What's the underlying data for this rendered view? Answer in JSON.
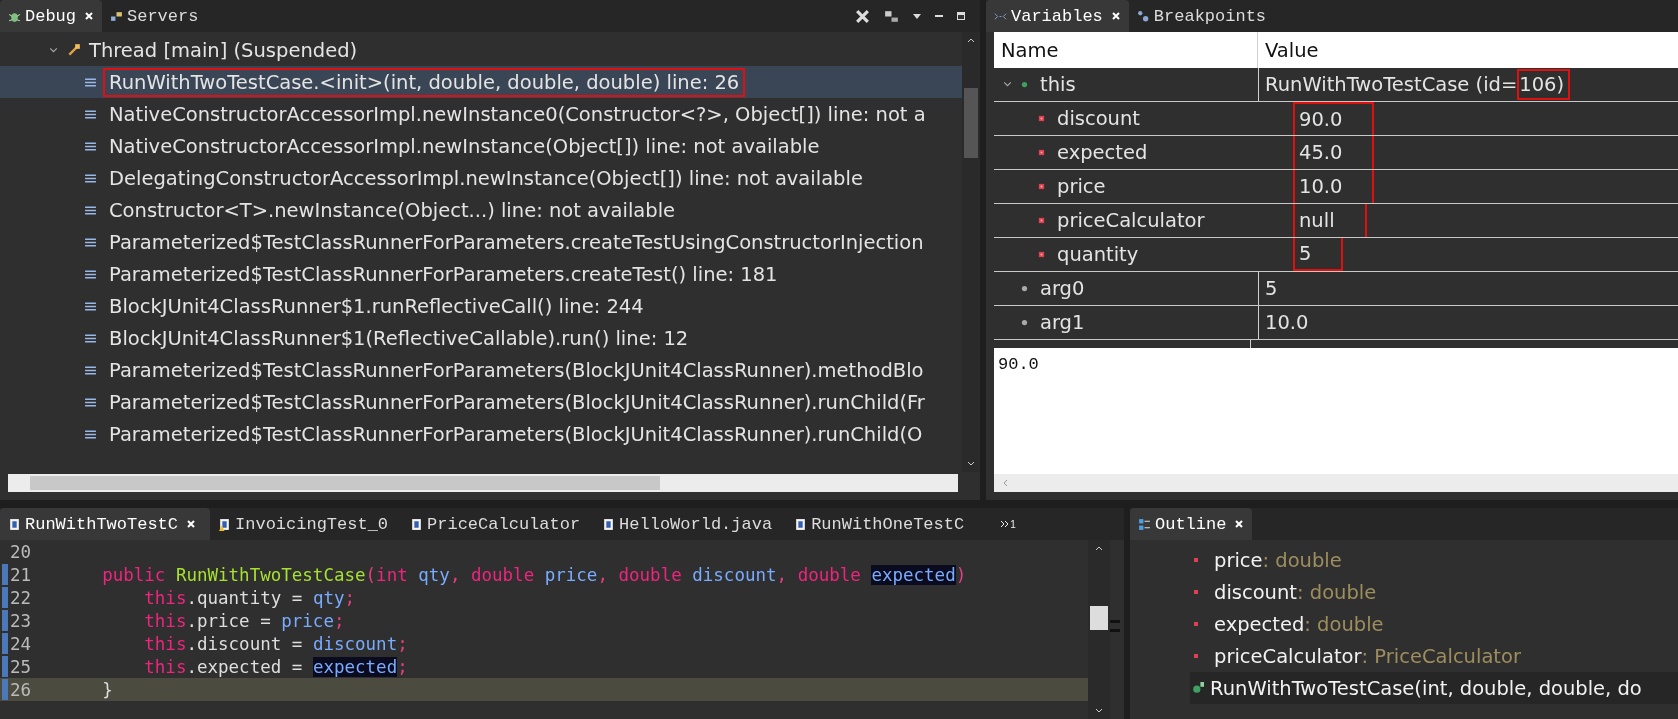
{
  "debug_view": {
    "tabs": [
      {
        "label": "Debug",
        "selected": true
      },
      {
        "label": "Servers",
        "selected": false
      }
    ],
    "thread": {
      "label": "Thread [main] (Suspended)",
      "expanded": true,
      "frames": [
        {
          "label": "RunWithTwoTestCase.<init>(int, double, double, double) line: 26",
          "selected": true,
          "boxed": true
        },
        {
          "label": "NativeConstructorAccessorImpl.newInstance0(Constructor<?>, Object[]) line: not a",
          "selected": false,
          "boxed": false
        },
        {
          "label": "NativeConstructorAccessorImpl.newInstance(Object[]) line: not available",
          "selected": false,
          "boxed": false
        },
        {
          "label": "DelegatingConstructorAccessorImpl.newInstance(Object[]) line: not available",
          "selected": false,
          "boxed": false
        },
        {
          "label": "Constructor<T>.newInstance(Object...) line: not available",
          "selected": false,
          "boxed": false
        },
        {
          "label": "Parameterized$TestClassRunnerForParameters.createTestUsingConstructorInjection",
          "selected": false,
          "boxed": false
        },
        {
          "label": "Parameterized$TestClassRunnerForParameters.createTest() line: 181",
          "selected": false,
          "boxed": false
        },
        {
          "label": "BlockJUnit4ClassRunner$1.runReflectiveCall() line: 244",
          "selected": false,
          "boxed": false
        },
        {
          "label": "BlockJUnit4ClassRunner$1(ReflectiveCallable).run() line: 12",
          "selected": false,
          "boxed": false
        },
        {
          "label": "Parameterized$TestClassRunnerForParameters(BlockJUnit4ClassRunner).methodBlo",
          "selected": false,
          "boxed": false
        },
        {
          "label": "Parameterized$TestClassRunnerForParameters(BlockJUnit4ClassRunner).runChild(Fr",
          "selected": false,
          "boxed": false
        },
        {
          "label": "Parameterized$TestClassRunnerForParameters(BlockJUnit4ClassRunner).runChild(O",
          "selected": false,
          "boxed": false
        }
      ]
    }
  },
  "variables_view": {
    "tabs": [
      {
        "label": "Variables",
        "selected": true
      },
      {
        "label": "Breakpoints",
        "selected": false
      }
    ],
    "columns": [
      "Name",
      "Value"
    ],
    "rows": [
      {
        "name": "this",
        "kind": "object",
        "expanded": true,
        "value": "RunWithTwoTestCase  (id=",
        "value_boxed": "106)",
        "boxed": false,
        "children": [
          {
            "name": "discount",
            "kind": "field",
            "value": "90.0",
            "boxed": true
          },
          {
            "name": "expected",
            "kind": "field",
            "value": "45.0",
            "boxed": true
          },
          {
            "name": "price",
            "kind": "field",
            "value": "10.0",
            "boxed": true
          },
          {
            "name": "priceCalculator",
            "kind": "field",
            "value": "null",
            "boxed": true
          },
          {
            "name": "quantity",
            "kind": "field",
            "value": "5",
            "boxed": true
          }
        ]
      },
      {
        "name": "arg0",
        "kind": "local",
        "value": "5",
        "boxed": false
      },
      {
        "name": "arg1",
        "kind": "local",
        "value": "10.0",
        "boxed": false
      }
    ],
    "detail": "90.0"
  },
  "editor": {
    "tabs": [
      {
        "label": "RunWithTwoTestC",
        "selected": true,
        "kind": "file"
      },
      {
        "label": "InvoicingTest_0",
        "selected": false,
        "kind": "warning"
      },
      {
        "label": "PriceCalculator",
        "selected": false,
        "kind": "file"
      },
      {
        "label": "HelloWorld.java",
        "selected": false,
        "kind": "file"
      },
      {
        "label": "RunWithOneTestC",
        "selected": false,
        "kind": "file"
      }
    ],
    "overflow_count": "1",
    "lines": [
      {
        "number": "20",
        "current": false
      },
      {
        "number": "21",
        "current": false,
        "tokens": [
          {
            "text": "    public ",
            "kind": "keyword"
          },
          {
            "text": "RunWithTwoTestCase",
            "kind": "method"
          },
          {
            "text": "(",
            "kind": "punct"
          },
          {
            "text": "int ",
            "kind": "keyword"
          },
          {
            "text": "qty",
            "kind": "param"
          },
          {
            "text": ", ",
            "kind": "punct"
          },
          {
            "text": "double ",
            "kind": "keyword"
          },
          {
            "text": "price",
            "kind": "param"
          },
          {
            "text": ", ",
            "kind": "punct"
          },
          {
            "text": "double ",
            "kind": "keyword"
          },
          {
            "text": "discount",
            "kind": "param"
          },
          {
            "text": ", ",
            "kind": "punct"
          },
          {
            "text": "double ",
            "kind": "keyword"
          },
          {
            "text": "expected",
            "kind": "occurrence"
          },
          {
            "text": ")",
            "kind": "punct"
          }
        ]
      },
      {
        "number": "22",
        "current": false,
        "tokens": [
          {
            "text": "        this",
            "kind": "keyword"
          },
          {
            "text": ".quantity = ",
            "kind": "field"
          },
          {
            "text": "qty",
            "kind": "param"
          },
          {
            "text": ";",
            "kind": "punct"
          }
        ]
      },
      {
        "number": "23",
        "current": false,
        "tokens": [
          {
            "text": "        this",
            "kind": "keyword"
          },
          {
            "text": ".price = ",
            "kind": "field"
          },
          {
            "text": "price",
            "kind": "param"
          },
          {
            "text": ";",
            "kind": "punct"
          }
        ]
      },
      {
        "number": "24",
        "current": false,
        "tokens": [
          {
            "text": "        this",
            "kind": "keyword"
          },
          {
            "text": ".discount = ",
            "kind": "field"
          },
          {
            "text": "discount",
            "kind": "param"
          },
          {
            "text": ";",
            "kind": "punct"
          }
        ]
      },
      {
        "number": "25",
        "current": false,
        "tokens": [
          {
            "text": "        this",
            "kind": "keyword"
          },
          {
            "text": ".expected = ",
            "kind": "field"
          },
          {
            "text": "expected",
            "kind": "occurrence"
          },
          {
            "text": ";",
            "kind": "punct"
          }
        ]
      },
      {
        "number": "26",
        "current": true,
        "tokens": [
          {
            "text": "    }",
            "kind": "field"
          }
        ]
      }
    ]
  },
  "outline_view": {
    "tabs": [
      {
        "label": "Outline",
        "selected": true
      }
    ],
    "items": [
      {
        "name": "price",
        "type": " : double",
        "kind": "field",
        "selected": false
      },
      {
        "name": "discount",
        "type": " : double",
        "kind": "field",
        "selected": false
      },
      {
        "name": "expected",
        "type": " : double",
        "kind": "field",
        "selected": false
      },
      {
        "name": "priceCalculator",
        "type": " : PriceCalculator",
        "kind": "field",
        "selected": false
      },
      {
        "name": "RunWithTwoTestCase(int, double, double, do",
        "kind": "constructor",
        "selected": true
      }
    ]
  }
}
